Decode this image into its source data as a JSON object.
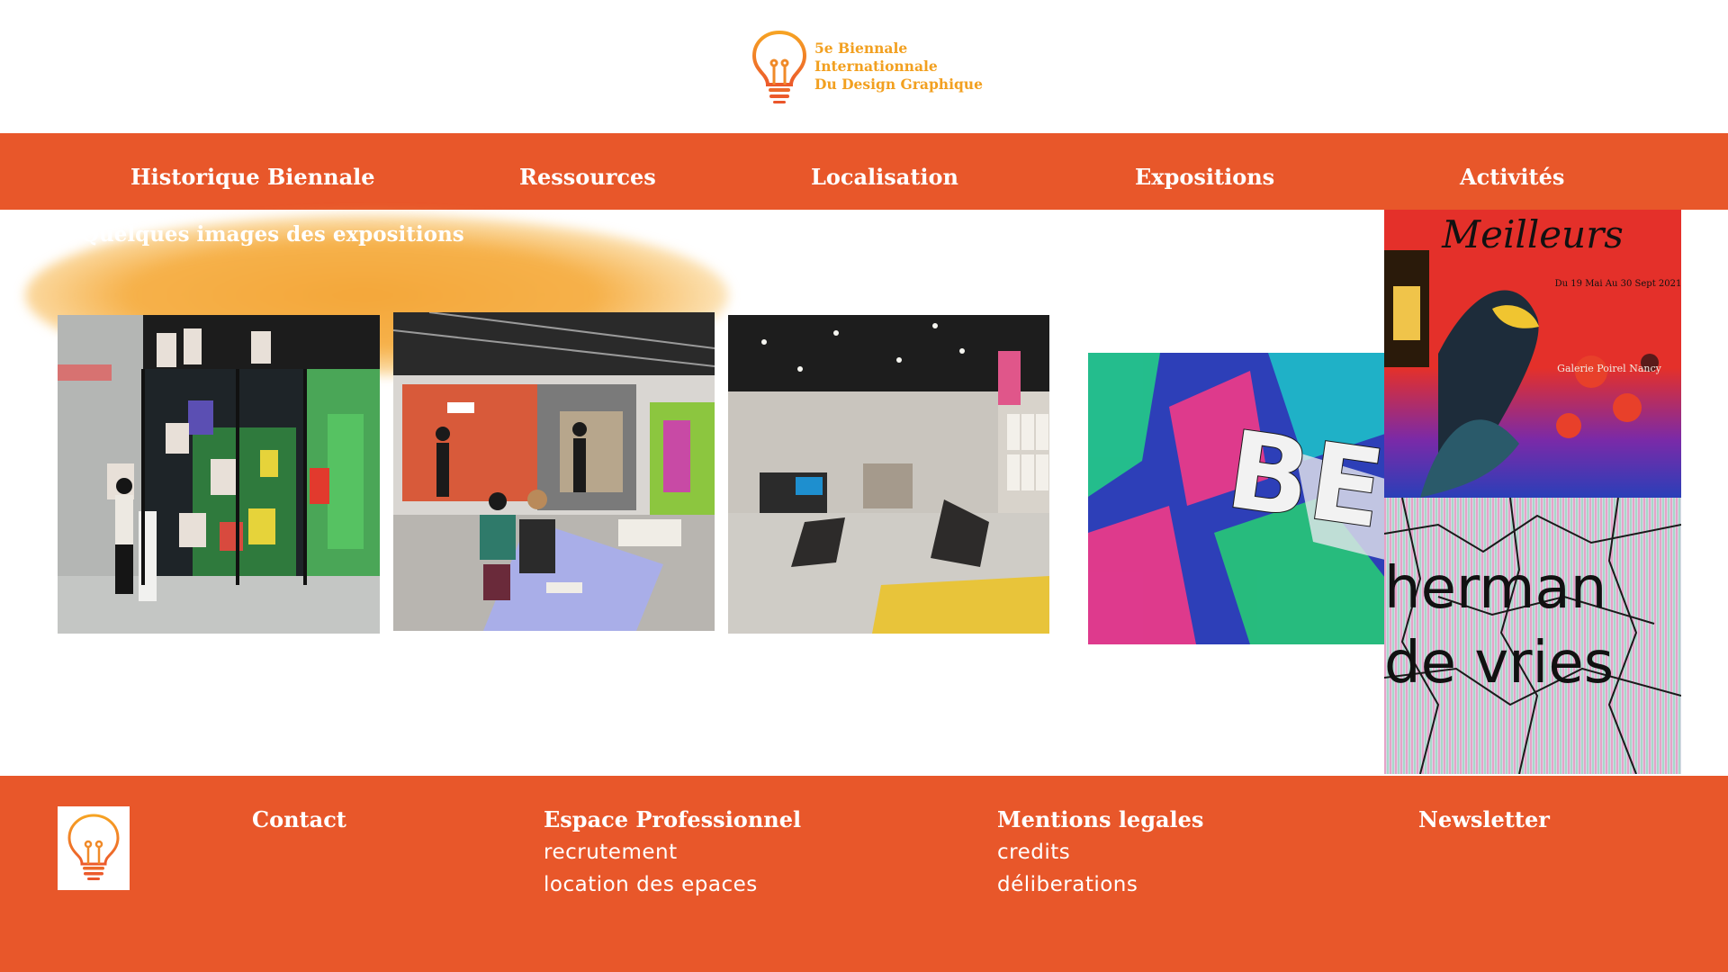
{
  "logo": {
    "line1": "5e Biennale",
    "line2": "Internationnale",
    "line3": "Du Design Graphique",
    "icon": "lightbulb-icon",
    "color": "#f2a020"
  },
  "nav": {
    "items": [
      "Historique Biennale",
      "Ressources",
      "Localisation",
      "Expositions",
      "Activités"
    ],
    "color": "#e8572a"
  },
  "main": {
    "section_title": "Quelques images des expositions",
    "glow_color": "#f4a73a",
    "posters": {
      "bel_ete": {
        "text": "BEL ÉTÉ"
      },
      "meilleurs": {
        "title": "Meilleurs",
        "dates": "Du 19 Mai Au 30 Sept 2021",
        "venue": "Galerie Poirel Nancy"
      },
      "herman": {
        "line1": "herman",
        "line2": "de vries"
      }
    }
  },
  "footer": {
    "contact": "Contact",
    "pro": {
      "title": "Espace Professionnel",
      "links": [
        "recrutement",
        "location des epaces"
      ]
    },
    "legal": {
      "title": "Mentions legales",
      "links": [
        "credits",
        "déliberations"
      ]
    },
    "newsletter": "Newsletter",
    "icon": "lightbulb-icon"
  }
}
